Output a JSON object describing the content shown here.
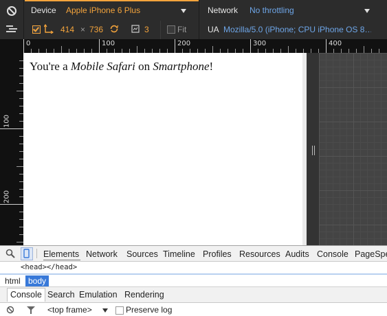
{
  "toolbar": {
    "device_label": "Device",
    "device_value": "Apple iPhone 6 Plus",
    "width_value": "414",
    "times_sign": "×",
    "height_value": "736",
    "dpr_value": "3",
    "fit_label": "Fit",
    "network_label": "Network",
    "network_value": "No throttling",
    "ua_label": "UA",
    "ua_value": "Mozilla/5.0 (iPhone; CPU iPhone OS 8…",
    "colors": {
      "accent_orange": "#f4a43c",
      "link_blue": "#6ea6e8",
      "bg": "#2c2c2c"
    }
  },
  "rulers": {
    "horizontal": [
      "0",
      "100",
      "200",
      "300",
      "400"
    ],
    "vertical": [
      "100",
      "200"
    ]
  },
  "page": {
    "text_before": "You're a ",
    "browser": "Mobile Safari",
    "text_middle": " on ",
    "device_type": "Smartphone",
    "text_after": "!"
  },
  "devtools": {
    "tabs": [
      "Elements",
      "Network",
      "Sources",
      "Timeline",
      "Profiles",
      "Resources",
      "Audits",
      "Console",
      "PageSpe"
    ],
    "active_tab": "Elements",
    "dom_line": "<head></head>",
    "breadcrumbs": [
      "html",
      "body"
    ],
    "selected_crumb": "body",
    "drawer_tabs": [
      "Console",
      "Search",
      "Emulation",
      "Rendering"
    ],
    "active_drawer_tab": "Console",
    "console_bar": {
      "frame": "<top frame>",
      "preserve_log": "Preserve log"
    }
  }
}
